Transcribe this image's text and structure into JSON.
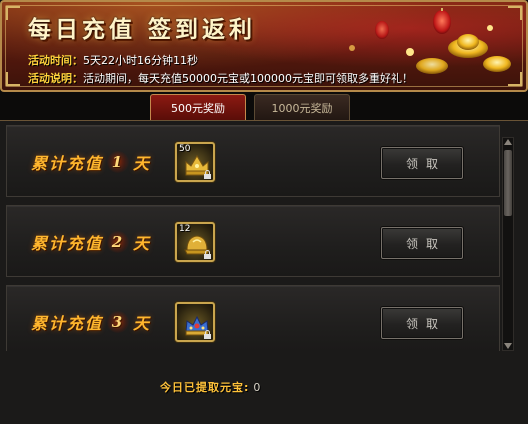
{
  "banner": {
    "title": "每日充值 签到返利",
    "time_label": "活动时间：",
    "time_value": "5天22小时16分钟11秒",
    "desc_label": "活动说明：",
    "desc_value": "活动期间，每天充值50000元宝或100000元宝即可领取多重好礼！"
  },
  "tabs": [
    {
      "label": "500元奖励",
      "active": true
    },
    {
      "label": "1000元奖励",
      "active": false
    }
  ],
  "rows": [
    {
      "prefix": "累计充值",
      "day": "1",
      "suffix": "天",
      "item_qty": "50",
      "item_icon": "gold-crown-icon",
      "button": "领取"
    },
    {
      "prefix": "累计充值",
      "day": "2",
      "suffix": "天",
      "item_qty": "12",
      "item_icon": "gold-helmet-icon",
      "button": "领取"
    },
    {
      "prefix": "累计充值",
      "day": "3",
      "suffix": "天",
      "item_qty": "",
      "item_icon": "jeweled-crown-icon",
      "button": "领取"
    }
  ],
  "footer": {
    "label": "今日已提取元宝:",
    "value": "0"
  },
  "colors": {
    "accent_gold": "#ffb62e",
    "tab_active": "#8c1a12",
    "panel_bg": "#1b1a19"
  }
}
